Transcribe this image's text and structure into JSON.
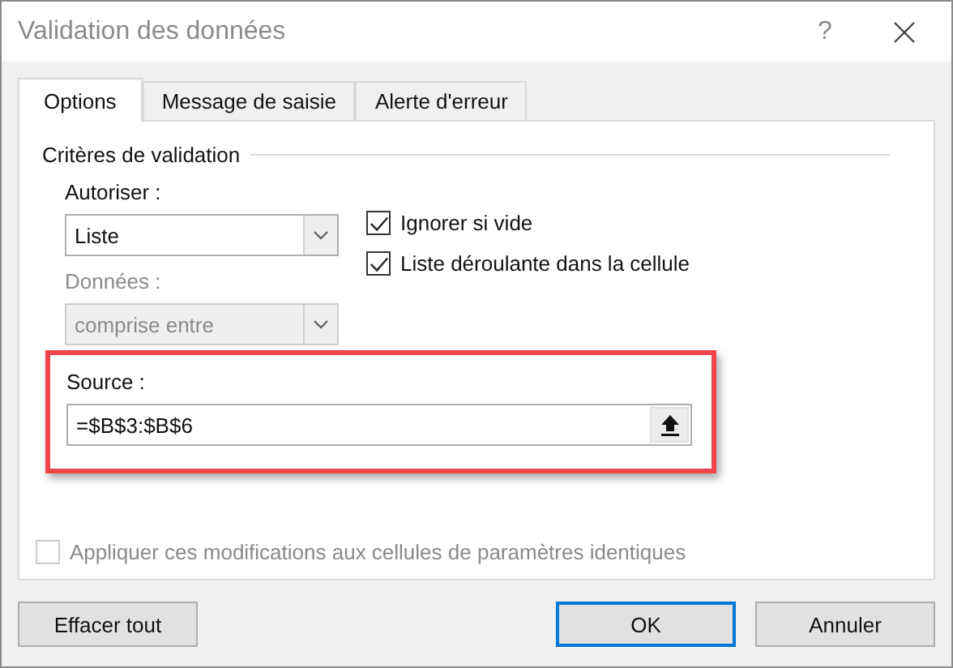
{
  "window": {
    "title": "Validation des données",
    "help": "?"
  },
  "tabs": [
    {
      "label": "Options",
      "selected": true
    },
    {
      "label": "Message de saisie",
      "selected": false
    },
    {
      "label": "Alerte d'erreur",
      "selected": false
    }
  ],
  "group": {
    "title": "Critères de validation"
  },
  "allow": {
    "label": "Autoriser :",
    "value": "Liste",
    "disabled": false
  },
  "data": {
    "label": "Données :",
    "value": "comprise entre",
    "disabled": true
  },
  "checkboxes": [
    {
      "label": "Ignorer si vide",
      "checked": true,
      "disabled": false
    },
    {
      "label": "Liste déroulante dans la cellule",
      "checked": true,
      "disabled": false
    }
  ],
  "source": {
    "label": "Source :",
    "value": "=$B$3:$B$6",
    "highlighted": true
  },
  "apply": {
    "label": "Appliquer ces modifications aux cellules de paramètres identiques",
    "checked": false,
    "disabled": true
  },
  "buttons": [
    {
      "label": "Effacer tout",
      "kind": "left",
      "default": false
    },
    {
      "label": "OK",
      "kind": "right",
      "default": true
    },
    {
      "label": "Annuler",
      "kind": "right",
      "default": false
    }
  ]
}
